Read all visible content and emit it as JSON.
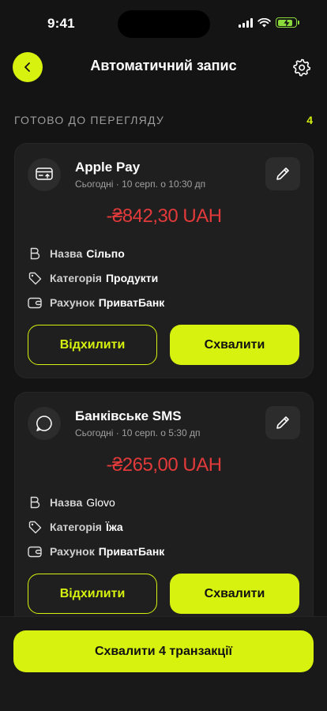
{
  "status_bar": {
    "time": "9:41"
  },
  "header": {
    "title": "Автоматичний запис"
  },
  "section": {
    "label": "ГОТОВО ДО ПЕРЕГЛЯДУ",
    "count": "4"
  },
  "cards": [
    {
      "source": "Apple Pay",
      "time": "Сьогодні · 10 серп. о 10:30 дп",
      "amount": "-₴842,30 UAH",
      "name_label": "Назва",
      "name_value": "Сільпо",
      "category_label": "Категорія",
      "category_value": "Продукти",
      "account_label": "Рахунок",
      "account_value": "ПриватБанк",
      "reject_label": "Відхилити",
      "approve_label": "Схвалити"
    },
    {
      "source": "Банківське SMS",
      "time": "Сьогодні · 10 серп. о 5:30 дп",
      "amount": "-₴265,00 UAH",
      "name_label": "Назва",
      "name_value": "Glovo",
      "category_label": "Категорія",
      "category_value": "Їжа",
      "account_label": "Рахунок",
      "account_value": "ПриватБанк",
      "reject_label": "Відхилити",
      "approve_label": "Схвалити"
    }
  ],
  "bottom": {
    "approve_all_label": "Схвалити 4 транзакції"
  },
  "colors": {
    "accent": "#d7f20f",
    "negative": "#e23a3a",
    "background": "#141414",
    "card": "#1f1f1f"
  }
}
